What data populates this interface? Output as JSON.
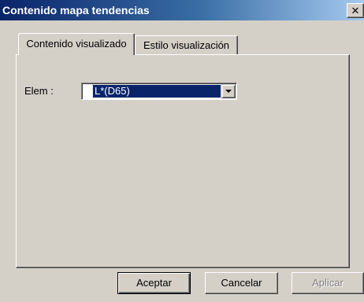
{
  "window": {
    "title": "Contenido mapa tendencias",
    "close_glyph": "✕"
  },
  "tabs": [
    {
      "label": "Contenido visualizado",
      "active": true
    },
    {
      "label": "Estilo visualización",
      "active": false
    }
  ],
  "elem": {
    "label": "Elem :",
    "selected_value": "L*(D65)"
  },
  "buttons": {
    "accept_label": "Aceptar",
    "cancel_label": "Cancelar",
    "apply_label": "Aplicar",
    "apply_enabled": false
  },
  "colors": {
    "title_bar": "#0a246a",
    "face": "#d4d0c8",
    "selection": "#0a246a"
  }
}
